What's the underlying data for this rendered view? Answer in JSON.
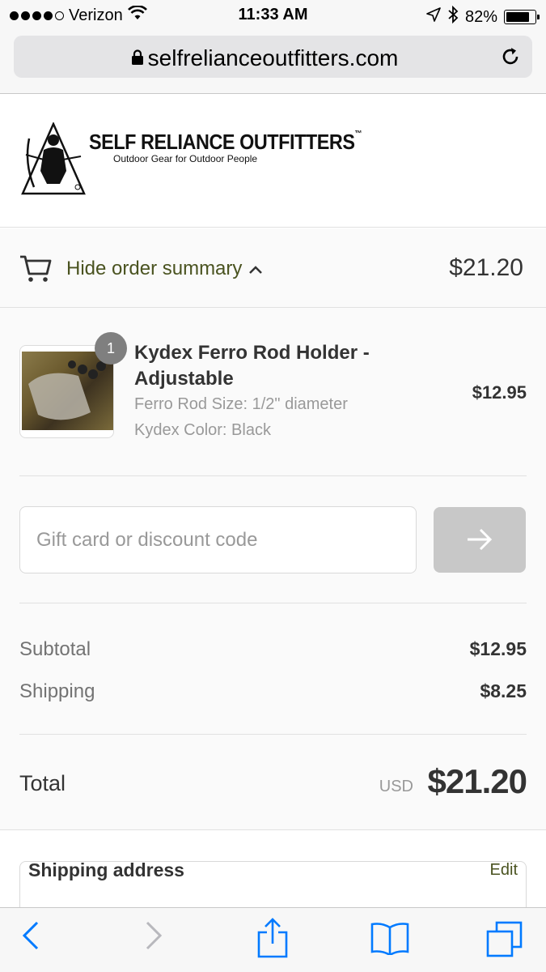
{
  "status_bar": {
    "carrier": "Verizon",
    "time": "11:33 AM",
    "battery": "82%",
    "battery_level": 0.82,
    "signal_bars_filled": 4,
    "signal_bars_total": 5
  },
  "browser": {
    "url": "selfrelianceoutfitters.com"
  },
  "brand": {
    "title": "SELF RELIANCE OUTFITTERS",
    "trademark": "™",
    "tagline": "Outdoor Gear for Outdoor People"
  },
  "summary": {
    "toggle_label": "Hide order summary",
    "toggle_total": "$21.20",
    "product": {
      "quantity": "1",
      "name": "Kydex Ferro Rod Holder - Adjustable",
      "option1": "Ferro Rod Size: 1/2\" diameter",
      "option2": "Kydex Color: Black",
      "price": "$12.95"
    },
    "discount": {
      "placeholder": "Gift card or discount code"
    },
    "lines": {
      "subtotal_label": "Subtotal",
      "subtotal_value": "$12.95",
      "shipping_label": "Shipping",
      "shipping_value": "$8.25"
    },
    "total": {
      "label": "Total",
      "currency": "USD",
      "value": "$21.20"
    }
  },
  "shipping_box": {
    "title": "Shipping address",
    "edit_label": "Edit"
  },
  "colors": {
    "accent": "#4a5320",
    "button_disabled": "#c8c8c8",
    "ios_blue": "#007aff"
  }
}
